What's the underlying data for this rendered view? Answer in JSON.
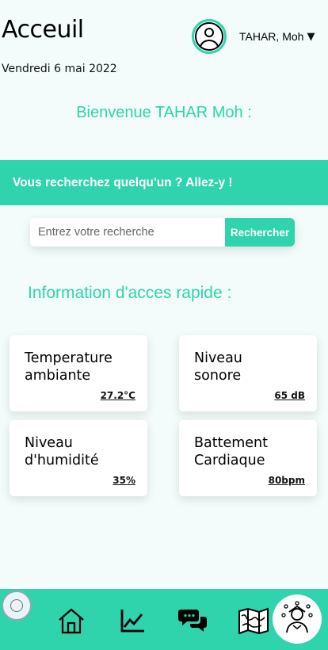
{
  "header": {
    "title": "Acceuil",
    "date": "Vendredi 6 mai 2022",
    "user_name": "TAHAR, Moh",
    "caret": "▼"
  },
  "welcome": "Bienvenue TAHAR Moh :",
  "banner": "Vous recherchez quelqu'un ? Allez-y !",
  "search": {
    "placeholder": "Entrez votre recherche",
    "button_label": "Rechercher"
  },
  "quick_info": {
    "title": "Information d'acces rapide :",
    "cards": [
      {
        "label": "Temperature\nambiante",
        "value": "27.2°C"
      },
      {
        "label": "Niveau\nsonore",
        "value": "65 dB"
      },
      {
        "label": "Niveau\nd'humidité",
        "value": "35%"
      },
      {
        "label": "Battement\nCardiaque",
        "value": "80bpm"
      }
    ]
  },
  "nav": {
    "items": [
      "home-icon",
      "chart-icon",
      "chat-icon",
      "map-icon"
    ],
    "accent": "#2fd3ac"
  }
}
